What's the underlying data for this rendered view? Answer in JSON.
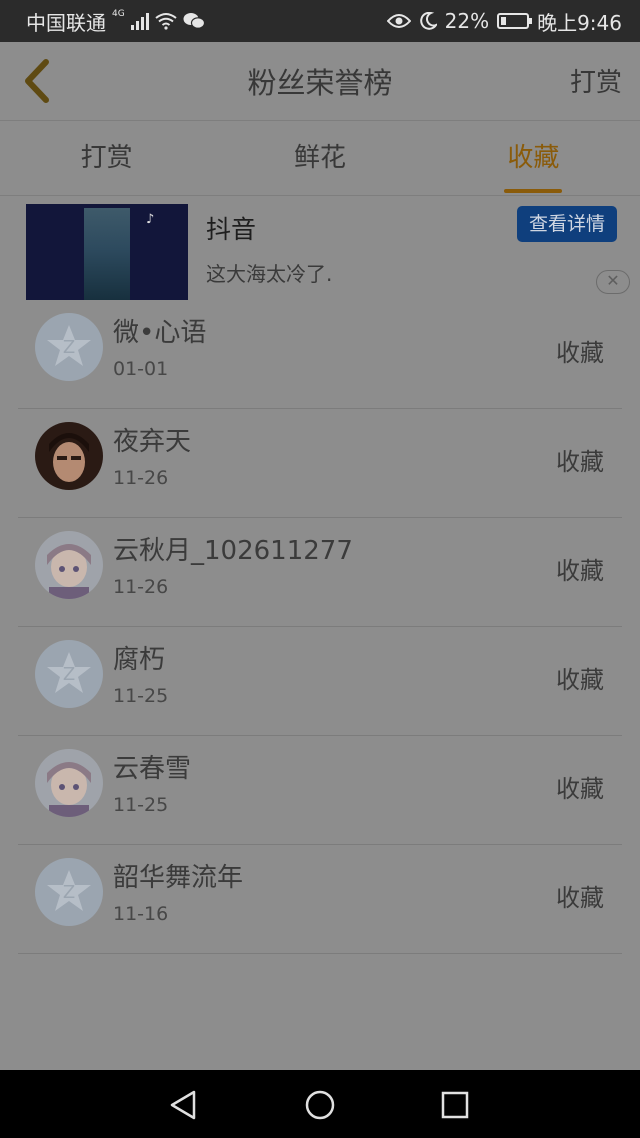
{
  "status_bar": {
    "carrier": "中国联通",
    "network": "4G",
    "battery": "22%",
    "battery_level": 0.22,
    "time": "晚上9:46"
  },
  "header": {
    "title": "粉丝荣誉榜",
    "right_action": "打赏"
  },
  "tabs": [
    {
      "label": "打赏"
    },
    {
      "label": "鲜花"
    },
    {
      "label": "收藏"
    }
  ],
  "active_tab": "收藏",
  "ad": {
    "app_name": "抖音",
    "description": "这大海太冷了.",
    "button": "查看详情"
  },
  "fans": [
    {
      "name": "微•心语",
      "date": "01-01",
      "action": "收藏",
      "avatar": "default-avatar"
    },
    {
      "name": "夜弃天",
      "date": "11-26",
      "action": "收藏",
      "avatar": "photo-avatar"
    },
    {
      "name": "云秋月_102611277",
      "date": "11-26",
      "action": "收藏",
      "avatar": "anime-avatar"
    },
    {
      "name": "腐朽",
      "date": "11-25",
      "action": "收藏",
      "avatar": "default-avatar"
    },
    {
      "name": "云春雪",
      "date": "11-25",
      "action": "收藏",
      "avatar": "anime-avatar"
    },
    {
      "name": "韶华舞流年",
      "date": "11-16",
      "action": "收藏",
      "avatar": "default-avatar"
    }
  ],
  "colors": {
    "accent": "#8a5b0a",
    "ad_button": "#0f3f7d",
    "status_bar": "#2b2b2b",
    "nav_bar": "#000000"
  }
}
